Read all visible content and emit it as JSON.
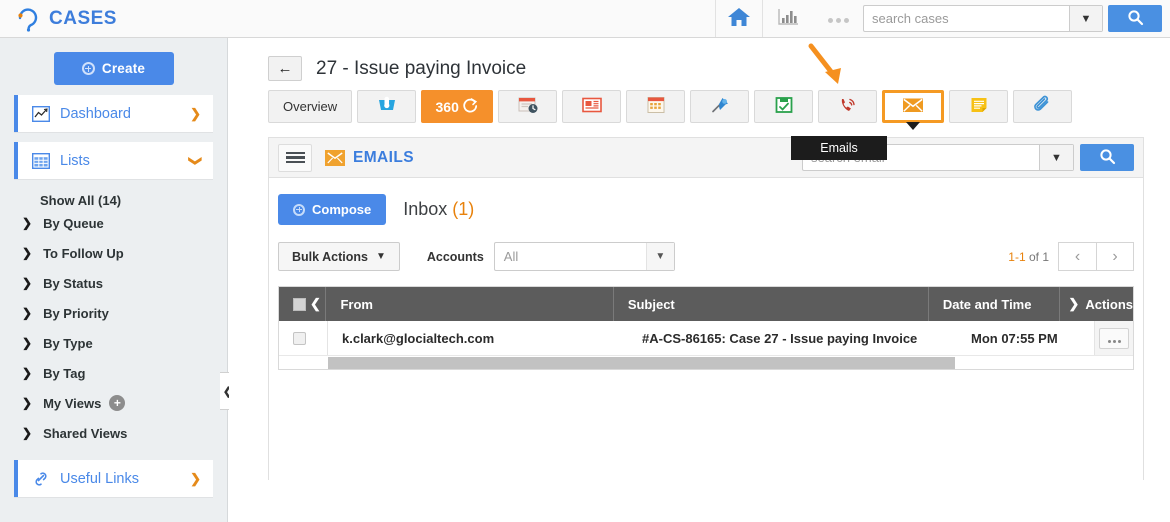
{
  "topbar": {
    "brand": "CASES",
    "home_icon": "home-icon",
    "chart_icon": "bar-chart-icon",
    "more_icon": "ellipsis-icon",
    "search_placeholder": "search cases",
    "search_value": "",
    "search_button_icon": "magnifier-icon",
    "dropdown_icon": "chevron-down-icon"
  },
  "sidebar": {
    "create_label": "Create",
    "nav": [
      {
        "label": "Dashboard",
        "icon": "dashboard-chart-icon",
        "chevron": "❯"
      },
      {
        "label": "Lists",
        "icon": "grid-table-icon",
        "chevron": "❯"
      }
    ],
    "show_all": "Show All (14)",
    "items": [
      {
        "label": "By Queue"
      },
      {
        "label": "To Follow Up"
      },
      {
        "label": "By Status"
      },
      {
        "label": "By Priority"
      },
      {
        "label": "By Type"
      },
      {
        "label": "By Tag"
      },
      {
        "label": "My Views",
        "badge": "+"
      },
      {
        "label": "Shared Views"
      }
    ],
    "useful_links": {
      "label": "Useful Links",
      "icon": "link-chain-icon",
      "chevron": "❯"
    },
    "collapse_icon": "❮"
  },
  "page": {
    "back_icon": "←",
    "title": "27 - Issue paying Invoice"
  },
  "tabs": [
    {
      "label": "Overview",
      "type": "text",
      "name": "tab-overview"
    },
    {
      "label": "",
      "type": "icon",
      "icon": "shield-thumb-icon",
      "name": "tab-sla"
    },
    {
      "label": "360",
      "type": "text",
      "name": "tab-360",
      "active": true
    },
    {
      "label": "",
      "type": "icon",
      "icon": "schedule-clock-icon",
      "name": "tab-schedule"
    },
    {
      "label": "",
      "type": "icon",
      "icon": "news-article-icon",
      "name": "tab-knowledge"
    },
    {
      "label": "",
      "type": "icon",
      "icon": "calendar-icon",
      "name": "tab-calendar"
    },
    {
      "label": "",
      "type": "icon",
      "icon": "pin-icon",
      "name": "tab-pinned"
    },
    {
      "label": "",
      "type": "icon",
      "icon": "save-tasks-icon",
      "name": "tab-tasks"
    },
    {
      "label": "",
      "type": "icon",
      "icon": "phone-call-icon",
      "name": "tab-calls"
    },
    {
      "label": "",
      "type": "icon",
      "icon": "envelope-icon",
      "name": "tab-emails",
      "selected": true
    },
    {
      "label": "",
      "type": "icon",
      "icon": "sticky-note-icon",
      "name": "tab-notes"
    },
    {
      "label": "",
      "type": "icon",
      "icon": "paperclip-icon",
      "name": "tab-attachments"
    }
  ],
  "tooltip": {
    "text": "Emails"
  },
  "annotation": {
    "arrow": "orange-arrow-pointing-at-emails-tab",
    "color": "#f5901f"
  },
  "panel": {
    "menu_icon": "hamburger-menu-icon",
    "mail_icon": "envelope-icon",
    "title": "EMAILS",
    "search_placeholder": "search email",
    "search_value": "",
    "search_button_icon": "magnifier-icon",
    "dropdown_icon": "chevron-down-icon",
    "compose_label": "Compose",
    "folder_label": "Inbox",
    "folder_count": "(1)",
    "bulk_actions_label": "Bulk Actions",
    "accounts_label": "Accounts",
    "accounts_value": "All",
    "pager": {
      "range": "1-1",
      "total": " of 1",
      "prev_icon": "‹",
      "next_icon": "›"
    }
  },
  "table": {
    "columns": [
      "From",
      "Subject",
      "Date and Time",
      "Actions"
    ],
    "from_sort_icon": "❮",
    "actions_sort_icon": "❯",
    "rows": [
      {
        "from": "k.clark@glocialtech.com",
        "subject": "#A-CS-86165: Case 27 - Issue paying Invoice",
        "date": "Mon 07:55 PM",
        "actions_icon": "ellipsis-icon"
      }
    ]
  },
  "colors": {
    "brand_blue": "#3d7ddb",
    "accent_blue": "#4a89e8",
    "orange": "#f59a23",
    "tab_orange": "#f5902b",
    "header_gray": "#5c5c5c"
  }
}
